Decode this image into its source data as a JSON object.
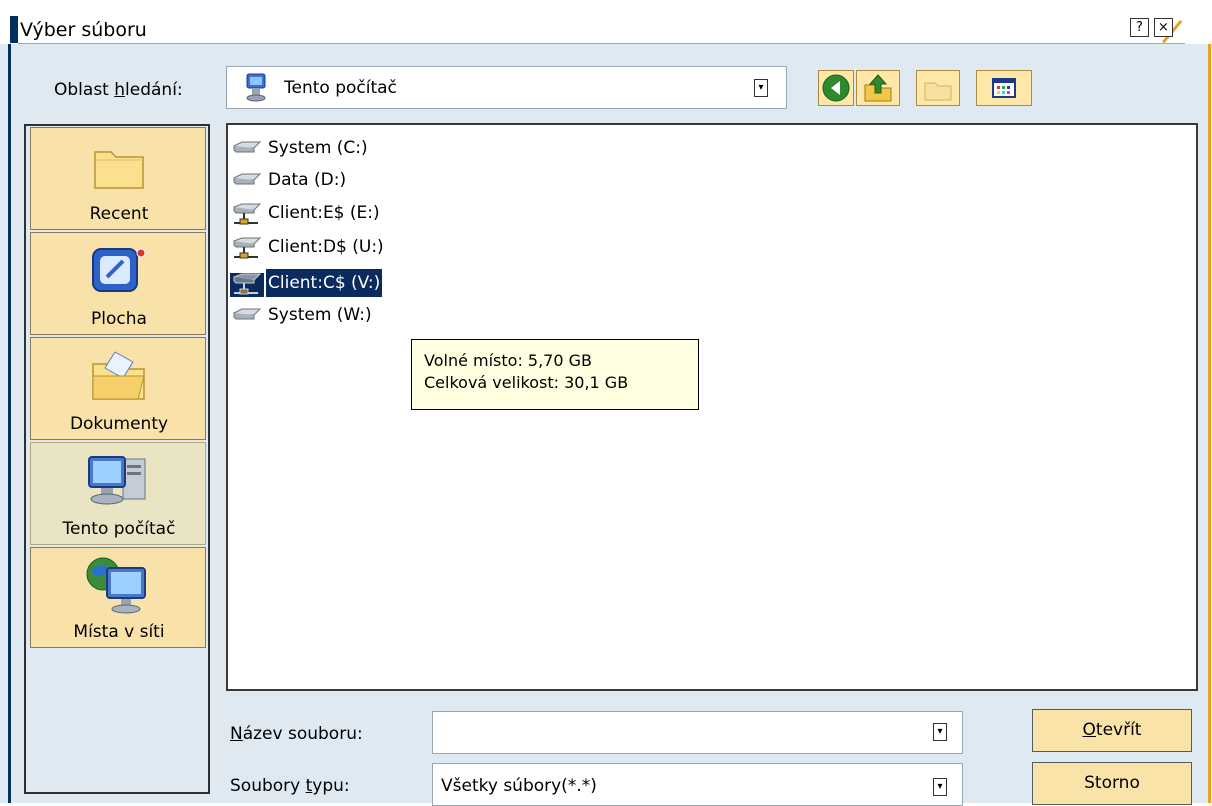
{
  "window": {
    "title": "Výber súboru",
    "help_glyph": "?",
    "close_glyph": "×"
  },
  "lookin": {
    "label_pre": "Oblast ",
    "label_ul": "h",
    "label_post": "ledání:",
    "value": "Tento počítač",
    "icon": "computer-icon"
  },
  "toolbar": {
    "back_icon": "back-arrow-icon",
    "up_icon": "up-folder-icon",
    "newfolder_icon": "new-folder-icon",
    "view_icon": "view-menu-icon"
  },
  "places": [
    {
      "label": "Recent",
      "icon": "folder-icon"
    },
    {
      "label": "Plocha",
      "icon": "desktop-icon"
    },
    {
      "label": "Dokumenty",
      "icon": "documents-folder-icon"
    },
    {
      "label": "Tento počítač",
      "icon": "my-computer-icon"
    },
    {
      "label": "Místa v síti",
      "icon": "network-places-icon"
    }
  ],
  "files": [
    {
      "label": "System (C:)",
      "type": "local-drive"
    },
    {
      "label": "Data (D:)",
      "type": "local-drive"
    },
    {
      "label": "Client:E$ (E:)",
      "type": "network-drive"
    },
    {
      "label": "Client:D$ (U:)",
      "type": "network-drive"
    },
    {
      "label": "Client:C$ (V:)",
      "type": "network-drive",
      "selected": true
    },
    {
      "label": "System (W:)",
      "type": "local-drive"
    }
  ],
  "tooltip": {
    "line1": "Volné místo: 5,70 GB",
    "line2": "Celková velikost: 30,1 GB"
  },
  "filename": {
    "label_ul": "N",
    "label_post": "ázev souboru:",
    "value": ""
  },
  "filetype": {
    "label_pre": "Soubory ",
    "label_ul": "t",
    "label_post": "ypu:",
    "value": "Všetky súbory(*.*)"
  },
  "buttons": {
    "open_ul": "O",
    "open_post": "tevřít",
    "cancel": "Storno"
  },
  "colors": {
    "accent_orange": "#e8a020",
    "accent_navy": "#00305e",
    "place_bg": "#f9e2a9",
    "selection": "#0b2a5e"
  }
}
